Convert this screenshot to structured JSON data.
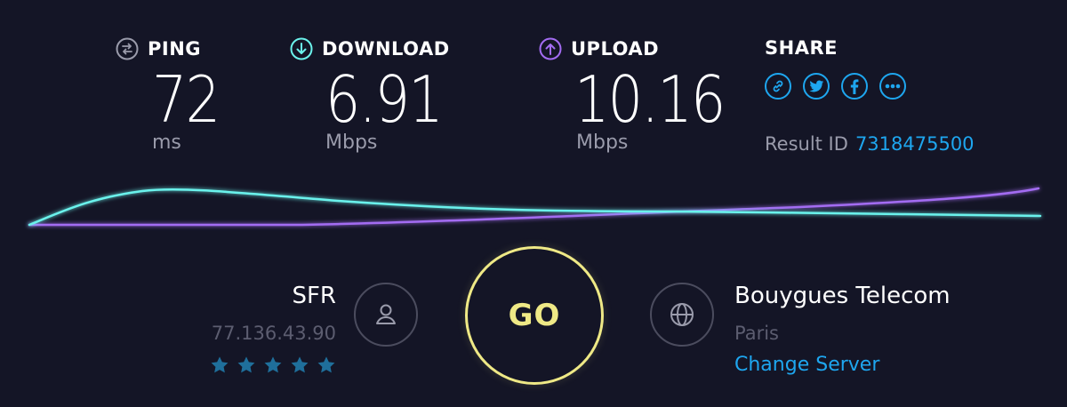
{
  "ping": {
    "label": "PING",
    "value": "72",
    "unit": "ms"
  },
  "download": {
    "label": "DOWNLOAD",
    "value": "6.91",
    "unit": "Mbps"
  },
  "upload": {
    "label": "UPLOAD",
    "value": "10.16",
    "unit": "Mbps"
  },
  "share": {
    "label": "SHARE",
    "buttons": [
      "link-icon",
      "twitter-icon",
      "facebook-icon",
      "more-icon"
    ],
    "result_id_label": "Result ID",
    "result_id": "7318475500"
  },
  "isp": {
    "name": "SFR",
    "ip": "77.136.43.90",
    "rating": 5,
    "icon": "user-icon"
  },
  "go_button": {
    "label": "GO"
  },
  "server": {
    "name": "Bouygues Telecom",
    "location": "Paris",
    "change_label": "Change Server",
    "icon": "globe-icon"
  },
  "colors": {
    "background": "#141526",
    "download": "#6bf2ec",
    "upload": "#a36cf2",
    "accent": "#1ea6ef",
    "go": "#efe986",
    "muted": "#9a9bab",
    "star": "#1f6f9b"
  }
}
